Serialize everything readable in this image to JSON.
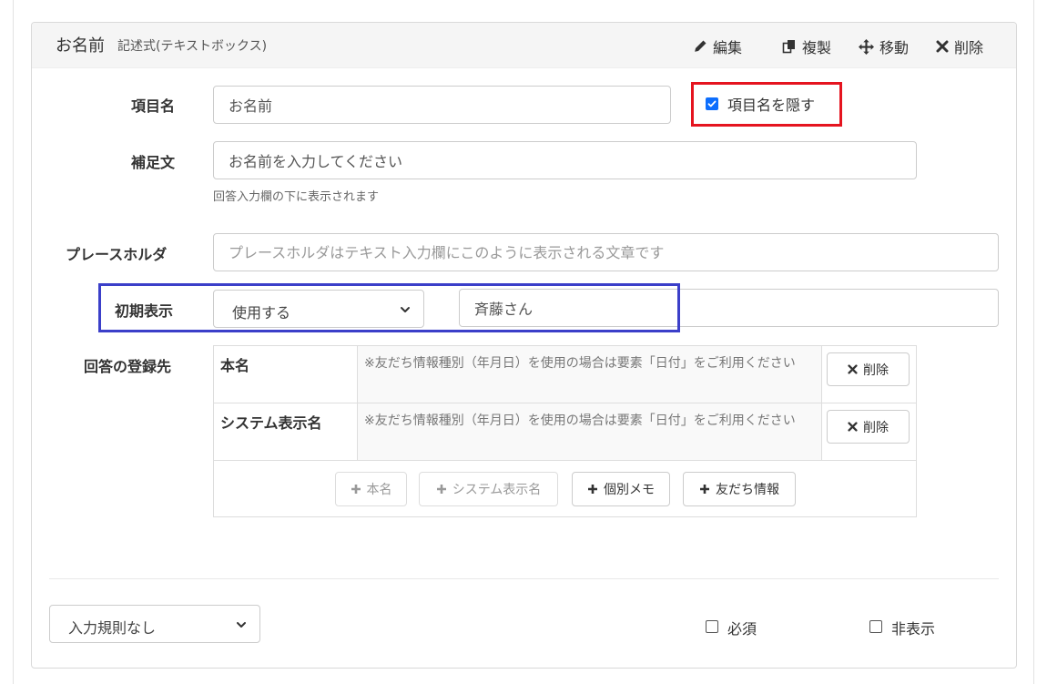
{
  "header": {
    "title": "お名前",
    "subtitle": "記述式(テキストボックス)",
    "actions": {
      "edit": "編集",
      "duplicate": "複製",
      "move": "移動",
      "delete": "削除"
    }
  },
  "fields": {
    "item_name": {
      "label": "項目名",
      "value": "お名前",
      "hide_label": "項目名を隠す",
      "hide_checked": true
    },
    "supplement": {
      "label": "補足文",
      "value": "お名前を入力してください",
      "help": "回答入力欄の下に表示されます"
    },
    "placeholder": {
      "label": "プレースホルダ",
      "placeholder": "プレースホルダはテキスト入力欄にこのように表示される文章です"
    },
    "initial": {
      "label": "初期表示",
      "select_value": "使用する",
      "value": "斉藤さん"
    }
  },
  "registration": {
    "label": "回答の登録先",
    "rows": [
      {
        "name": "本名",
        "note": "※友だち情報種別（年月日）を使用の場合は要素「日付」をご利用ください",
        "delete": "削除"
      },
      {
        "name": "システム表示名",
        "note": "※友だち情報種別（年月日）を使用の場合は要素「日付」をご利用ください",
        "delete": "削除"
      }
    ],
    "add_buttons": [
      {
        "label": "本名",
        "enabled": false
      },
      {
        "label": "システム表示名",
        "enabled": false
      },
      {
        "label": "個別メモ",
        "enabled": true
      },
      {
        "label": "友だち情報",
        "enabled": true
      }
    ]
  },
  "footer": {
    "rule_select": "入力規則なし",
    "required_label": "必須",
    "hidden_label": "非表示",
    "required_checked": false,
    "hidden_checked": false
  },
  "colors": {
    "highlight_red": "#e5141f",
    "highlight_blue": "#3b3fc9",
    "checkbox_blue": "#0d6efd"
  }
}
